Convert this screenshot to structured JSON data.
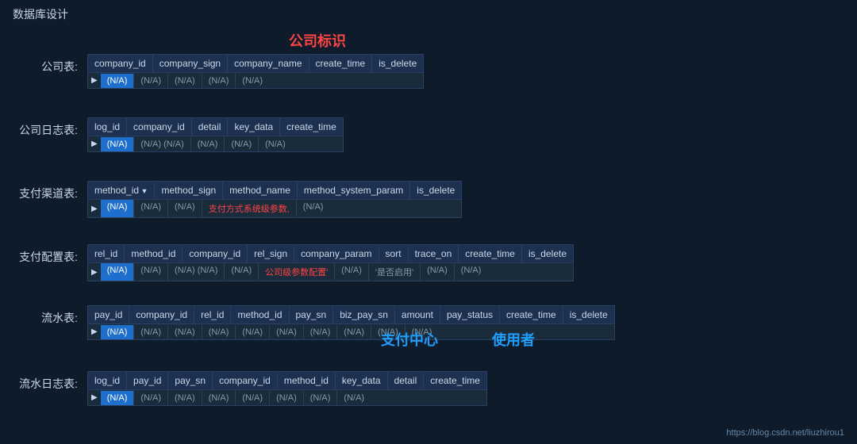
{
  "page": {
    "title": "数据库设计",
    "company_label": "公司标识",
    "bottom_link": "https://blog.csdn.net/liuzhirou1"
  },
  "sections": [
    {
      "id": "company",
      "label": "公司表:",
      "columns": [
        "company_id",
        "company_sign",
        "company_name",
        "create_time",
        "is_delete"
      ],
      "row": [
        "(N/A)",
        "(N/A)",
        "(N/A)",
        "(N/A)",
        "(N/A)"
      ],
      "highlighted_col": 0,
      "arrow_col": -1
    },
    {
      "id": "log",
      "label": "公司日志表:",
      "columns": [
        "log_id",
        "company_id",
        "detail",
        "key_data",
        "create_time"
      ],
      "row": [
        "(N/A)",
        "(N/A) (N/A)",
        "(N/A)",
        "(N/A)",
        "(N/A)"
      ],
      "highlighted_col": 0,
      "arrow_col": -1
    },
    {
      "id": "method",
      "label": "支付渠道表:",
      "columns": [
        "method_id",
        "method_sign",
        "method_name",
        "method_system_param",
        "is_delete"
      ],
      "row": [
        "(N/A)",
        "(N/A)",
        "(N/A)",
        "支付方式系统级参数,",
        "(N/A)"
      ],
      "highlighted_col": 0,
      "arrow_col": 0,
      "red_col": 3
    },
    {
      "id": "config",
      "label": "支付配置表:",
      "columns": [
        "rel_id",
        "method_id",
        "company_id",
        "rel_sign",
        "company_param",
        "sort",
        "trace_on",
        "create_time",
        "is_delete"
      ],
      "row": [
        "(N/A)",
        "(N/A)",
        "(N/A) (N/A)",
        "(N/A)",
        "公司级参数配置'",
        "(N/A)",
        "'是否启用'",
        "(N/A)",
        "(N/A)"
      ],
      "highlighted_col": 0,
      "arrow_col": -1,
      "red_col": 4
    },
    {
      "id": "flow",
      "label": "流水表:",
      "columns": [
        "pay_id",
        "company_id",
        "rel_id",
        "method_id",
        "pay_sn",
        "biz_pay_sn",
        "amount",
        "pay_status",
        "create_time",
        "is_delete"
      ],
      "row": [
        "(N/A)",
        "(N/A)",
        "(N/A)",
        "(N/A)",
        "(N/A)",
        "(N/A)",
        "(N/A)",
        "(N/A)",
        "(N/A)",
        "(N/A)"
      ],
      "highlighted_col": 0,
      "arrow_col": -1,
      "annotation1": "支付中心",
      "annotation2": "使用者"
    },
    {
      "id": "flowlog",
      "label": "流水日志表:",
      "columns": [
        "log_id",
        "pay_id",
        "pay_sn",
        "company_id",
        "method_id",
        "key_data",
        "detail",
        "create_time"
      ],
      "row": [
        "(N/A)",
        "(N/A)",
        "(N/A)",
        "(N/A)",
        "(N/A)",
        "(N/A)",
        "(N/A)",
        "(N/A)"
      ],
      "highlighted_col": 0,
      "arrow_col": -1
    }
  ]
}
